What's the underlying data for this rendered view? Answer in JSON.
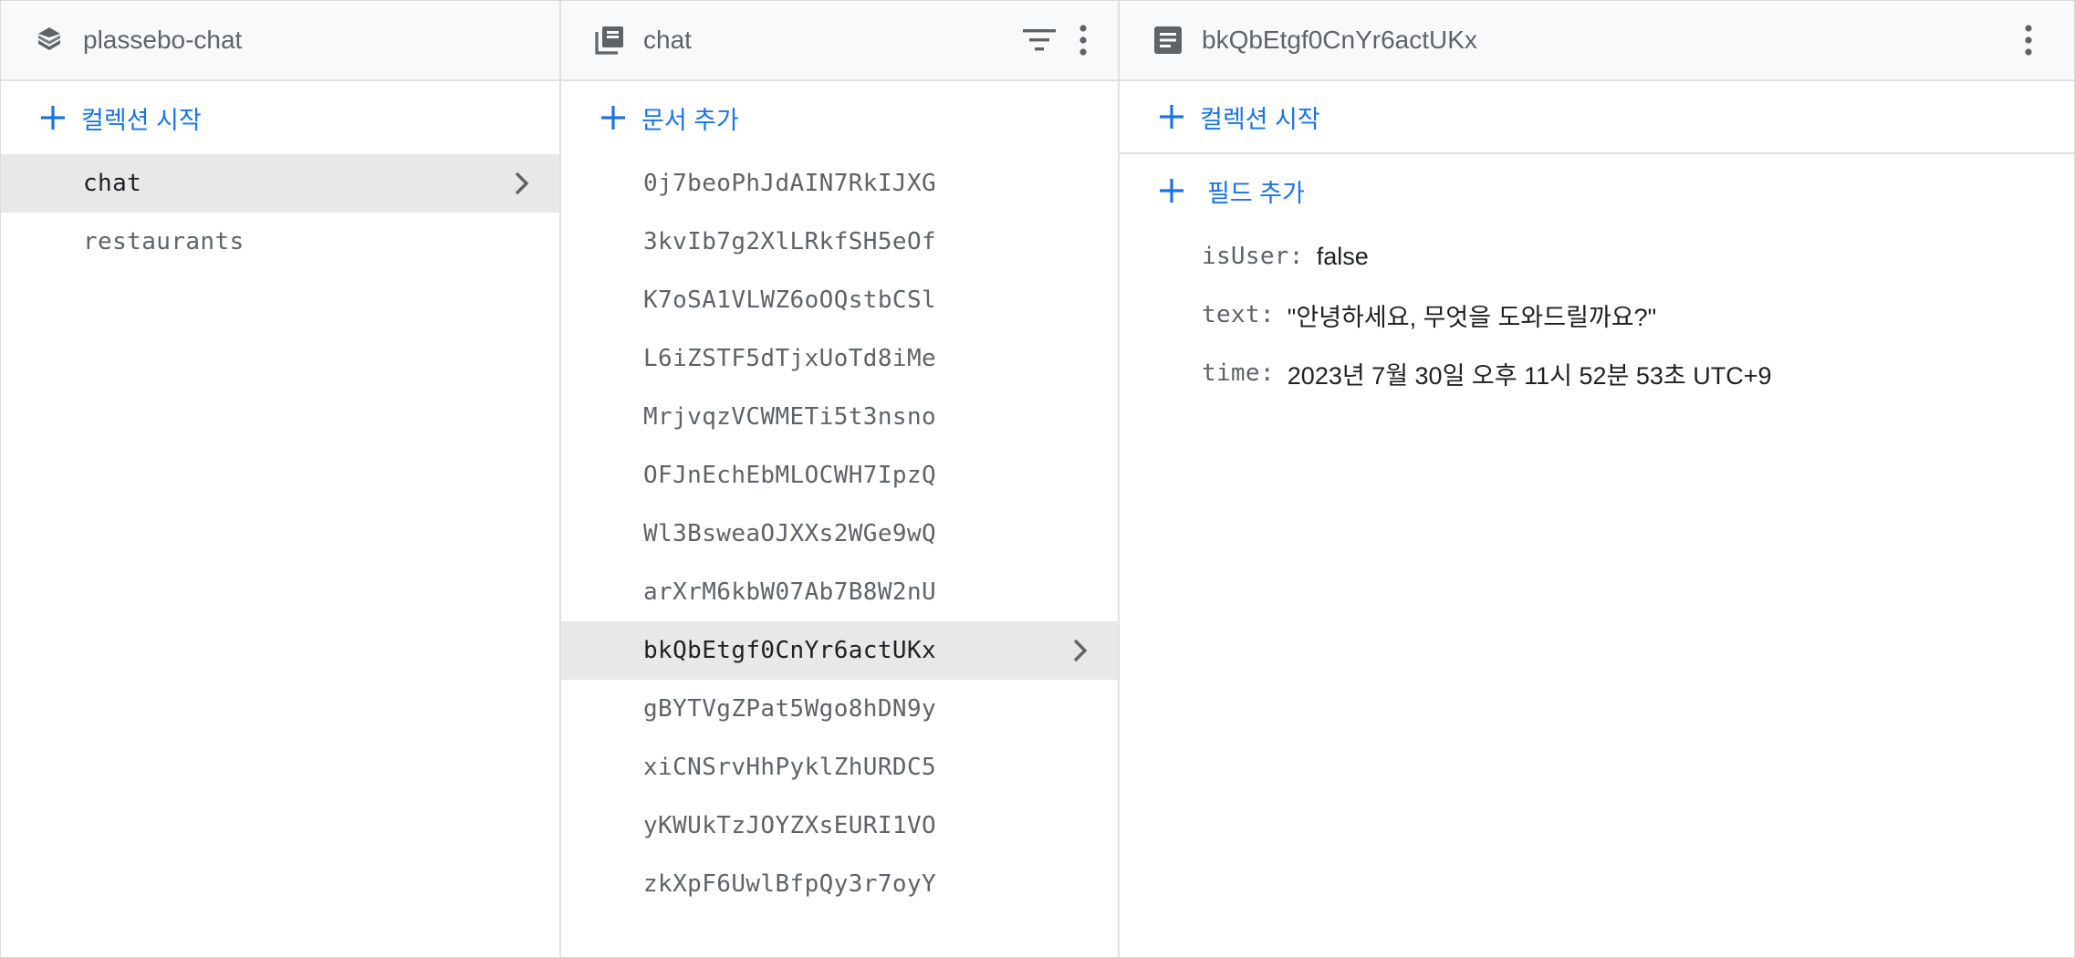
{
  "root_panel": {
    "title": "plassebo-chat",
    "icon": "firestore-stack-icon",
    "add_label": "컬렉션 시작",
    "collections": [
      {
        "label": "chat",
        "selected": true
      },
      {
        "label": "restaurants",
        "selected": false
      }
    ]
  },
  "collection_panel": {
    "title": "chat",
    "icon": "collection-icon",
    "add_label": "문서 추가",
    "documents": [
      "0j7beoPhJdAIN7RkIJXG",
      "3kvIb7g2XlLRkfSH5eOf",
      "K7oSA1VLWZ6oOQstbCSl",
      "L6iZSTF5dTjxUoTd8iMe",
      "MrjvqzVCWMETi5t3nsno",
      "OFJnEchEbMLOCWH7IpzQ",
      "Wl3BsweaOJXXs2WGe9wQ",
      "arXrM6kbW07Ab7B8W2nU",
      "bkQbEtgf0CnYr6actUKx",
      "gBYTVgZPat5Wgo8hDN9y",
      "xiCNSrvHhPyklZhURDC5",
      "yKWUkTzJOYZXsEURI1VO",
      "zkXpF6UwlBfpQy3r7oyY"
    ],
    "selected_index": 8
  },
  "document_panel": {
    "title": "bkQbEtgf0CnYr6actUKx",
    "icon": "document-icon",
    "add_collection_label": "컬렉션 시작",
    "add_field_label": "필드 추가",
    "fields": [
      {
        "key": "isUser:",
        "value": "false"
      },
      {
        "key": "text:",
        "value": "\"안녕하세요, 무엇을 도와드릴까요?\""
      },
      {
        "key": "time:",
        "value": "2023년 7월 30일 오후 11시 52분 53초 UTC+9"
      }
    ]
  },
  "colors": {
    "accent": "#1a73e8",
    "header_bg": "#f8f9fa",
    "selected_bg": "#e8e8e8",
    "muted_text": "#5f6368",
    "border": "#e0e0e0"
  }
}
